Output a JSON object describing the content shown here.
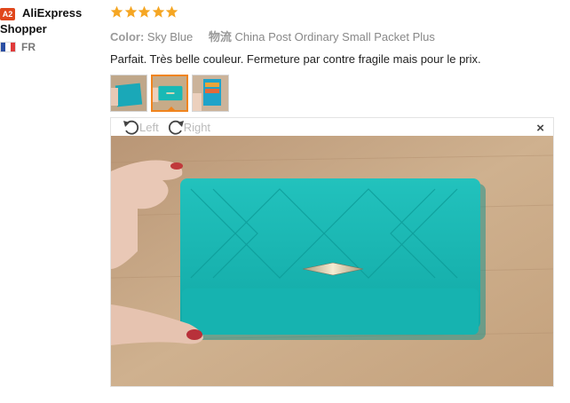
{
  "user": {
    "level_badge": "A2",
    "name_line1": "AliExpress",
    "name_line2": "Shopper",
    "country_code": "FR"
  },
  "review": {
    "rating": 5,
    "color_label": "Color:",
    "color_value": "Sky Blue",
    "shipping_label": "物流",
    "shipping_value": "China Post Ordinary Small Packet Plus",
    "text": "Parfait. Très belle couleur. Fermeture par contre fragile mais pour le prix."
  },
  "viewer": {
    "rotate_left_label": "Left",
    "rotate_right_label": "Right",
    "close_label": "×"
  },
  "colors": {
    "star": "#f5a623",
    "badge": "#e0471c",
    "active_thumb": "#f0841e",
    "wallet": "#19b9b5",
    "table": "#c9aa86"
  }
}
